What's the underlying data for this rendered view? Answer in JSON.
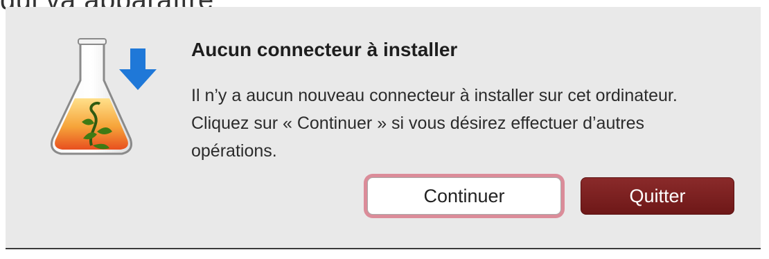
{
  "caption": "qui va apparaître",
  "dialog": {
    "title": "Aucun connecteur à installer",
    "message": "Il n’y a aucun nouveau connecteur à installer sur cet ordinateur. Cliquez sur « Continuer » si vous désirez effectuer d’autres opérations.",
    "buttons": {
      "continue_label": "Continuer",
      "quit_label": "Quitter"
    },
    "icon": "installer-flask-download-icon",
    "colors": {
      "dialog_bg": "#e9e9e9",
      "primary_button": "#7a1f1f",
      "focus_ring": "#d66c7d",
      "arrow_blue": "#1f78d8"
    }
  }
}
